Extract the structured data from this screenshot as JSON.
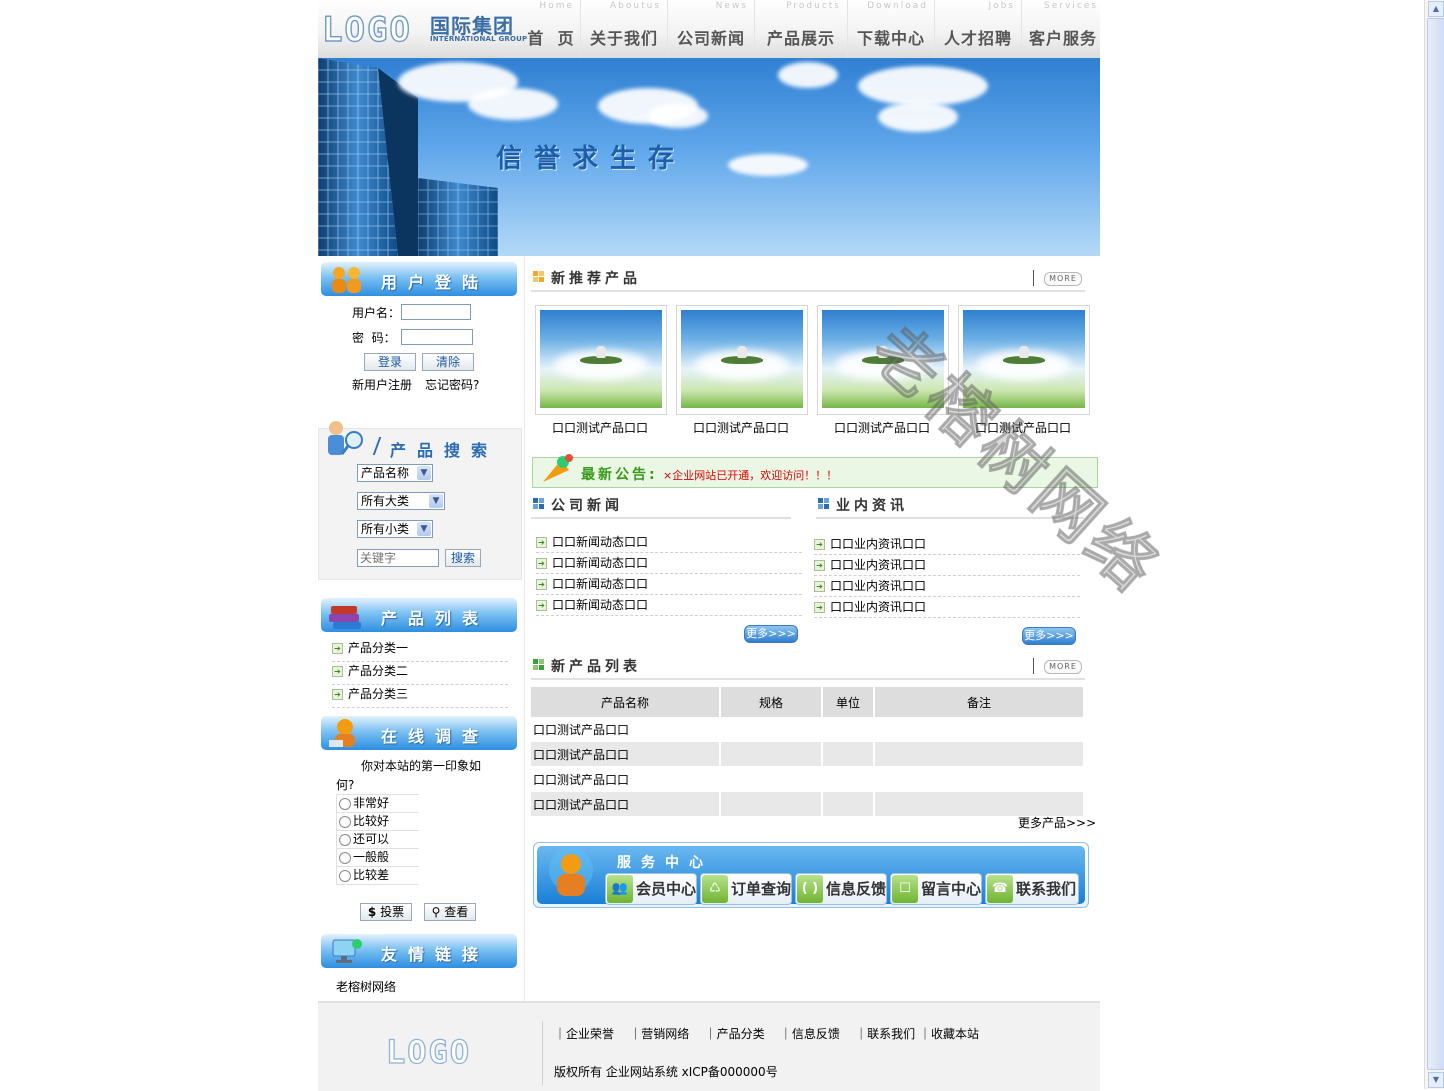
{
  "header": {
    "logo": "LOGO",
    "brand_cn": "国际集团",
    "brand_en": "INTERNATIONAL GROUP",
    "nav": [
      {
        "cn": "首  页",
        "en": "Home"
      },
      {
        "cn": "关于我们",
        "en": "Aboutus"
      },
      {
        "cn": "公司新闻",
        "en": "News"
      },
      {
        "cn": "产品展示",
        "en": "Products"
      },
      {
        "cn": "下载中心",
        "en": "Download"
      },
      {
        "cn": "人才招聘",
        "en": "Jobs"
      },
      {
        "cn": "客户服务",
        "en": "Services"
      }
    ]
  },
  "banner": {
    "slogan": "信誉求生存"
  },
  "login": {
    "title": "用户登陆",
    "username_label": "用户名：",
    "password_label": "密  码：",
    "login_btn": "登录",
    "clear_btn": "清除",
    "register": "新用户注册",
    "forgot": "忘记密码?"
  },
  "search": {
    "title": "产品搜索",
    "select_name": "产品名称",
    "select_big": "所有大类",
    "select_small": "所有小类",
    "keyword_placeholder": "关键字",
    "btn": "搜索"
  },
  "product_list": {
    "title": "产品列表",
    "items": [
      "产品分类一",
      "产品分类二",
      "产品分类三"
    ]
  },
  "survey": {
    "title": "在线调查",
    "question_line1": "你对本站的第一印象如",
    "question_line2": "何?",
    "options": [
      "非常好",
      "比较好",
      "还可以",
      "一般般",
      "比较差"
    ],
    "vote_btn": "投票",
    "view_btn": "查看"
  },
  "links": {
    "title": "友情链接",
    "items": [
      "老榕树网络"
    ]
  },
  "recommend": {
    "title": "新推荐产品",
    "more": "MORE",
    "products": [
      "口口测试产品口口",
      "口口测试产品口口",
      "口口测试产品口口",
      "口口测试产品口口"
    ]
  },
  "notice": {
    "label": "最新公告:",
    "text": "×企业网站已开通，欢迎访问！！！"
  },
  "company_news": {
    "title": "公司新闻",
    "items": [
      "口口新闻动态口口",
      "口口新闻动态口口",
      "口口新闻动态口口",
      "口口新闻动态口口"
    ],
    "more": "更多>>>"
  },
  "industry_news": {
    "title": "业内资讯",
    "items": [
      "口口业内资讯口口",
      "口口业内资讯口口",
      "口口业内资讯口口",
      "口口业内资讯口口"
    ],
    "more": "更多>>>"
  },
  "new_products": {
    "title": "新产品列表",
    "more": "MORE",
    "columns": [
      "产品名称",
      "规格",
      "单位",
      "备注"
    ],
    "rows": [
      [
        "口口测试产品口口",
        "",
        "",
        ""
      ],
      [
        "口口测试产品口口",
        "",
        "",
        ""
      ],
      [
        "口口测试产品口口",
        "",
        "",
        ""
      ],
      [
        "口口测试产品口口",
        "",
        "",
        ""
      ]
    ],
    "more_link": "更多产品>>>"
  },
  "service": {
    "title": "服务中心",
    "items": [
      "会员中心",
      "订单查询",
      "信息反馈",
      "留言中心",
      "联系我们"
    ]
  },
  "footer": {
    "logo": "LOGO",
    "links": [
      "｜企业荣誉",
      "｜营销网络",
      "｜产品分类",
      "｜信息反馈",
      "｜联系我们",
      "｜收藏本站"
    ],
    "copyright": "版权所有 企业网站系统 xICP备000000号"
  },
  "watermark": "老榕树网络",
  "colors": {
    "accent": "#2e8ee0",
    "notice_text": "#e00000",
    "notice_label": "#3a9a1a"
  }
}
